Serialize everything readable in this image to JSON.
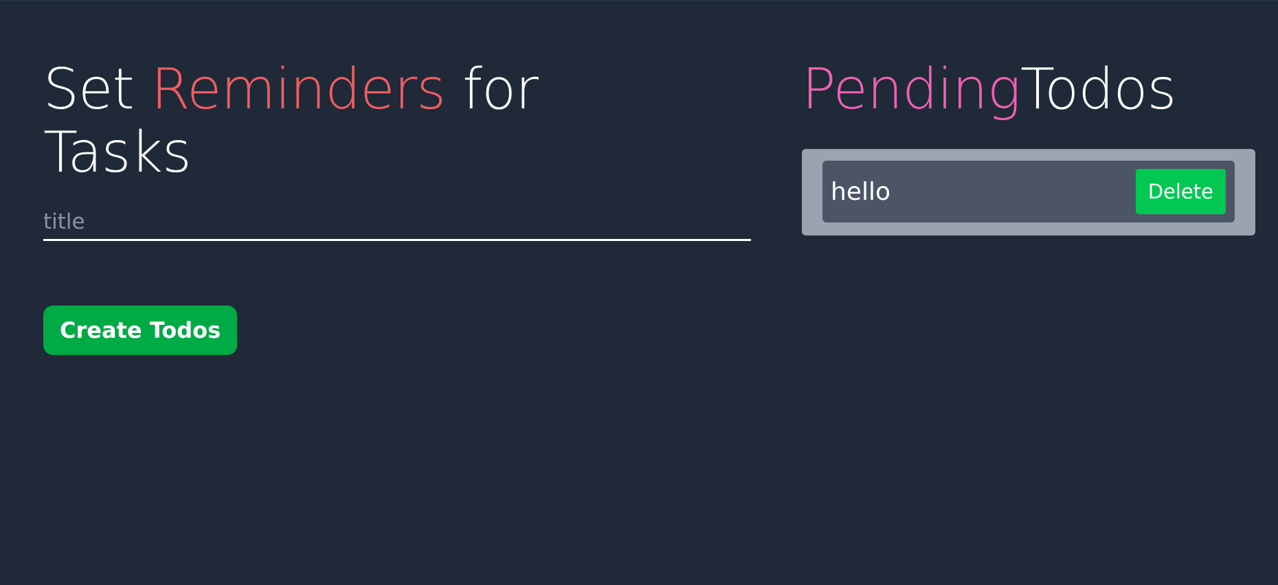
{
  "form": {
    "heading": {
      "part1": "Set ",
      "part2": "Reminders",
      "part3": " for",
      "part4": "Tasks"
    },
    "title_input": {
      "placeholder": "title",
      "value": ""
    },
    "create_label": "Create Todos"
  },
  "pending": {
    "heading": {
      "part1": "Pending",
      "part2": "Todos"
    },
    "items": [
      {
        "text": "hello",
        "delete_label": "Delete"
      }
    ]
  },
  "colors": {
    "background": "#1f2937",
    "accent_red": "#f05d63",
    "accent_pink": "#ef5fb3",
    "button_green": "#00aa45",
    "delete_green": "#00c853",
    "panel_gray": "#9aa3af",
    "item_gray": "#4b5565"
  }
}
